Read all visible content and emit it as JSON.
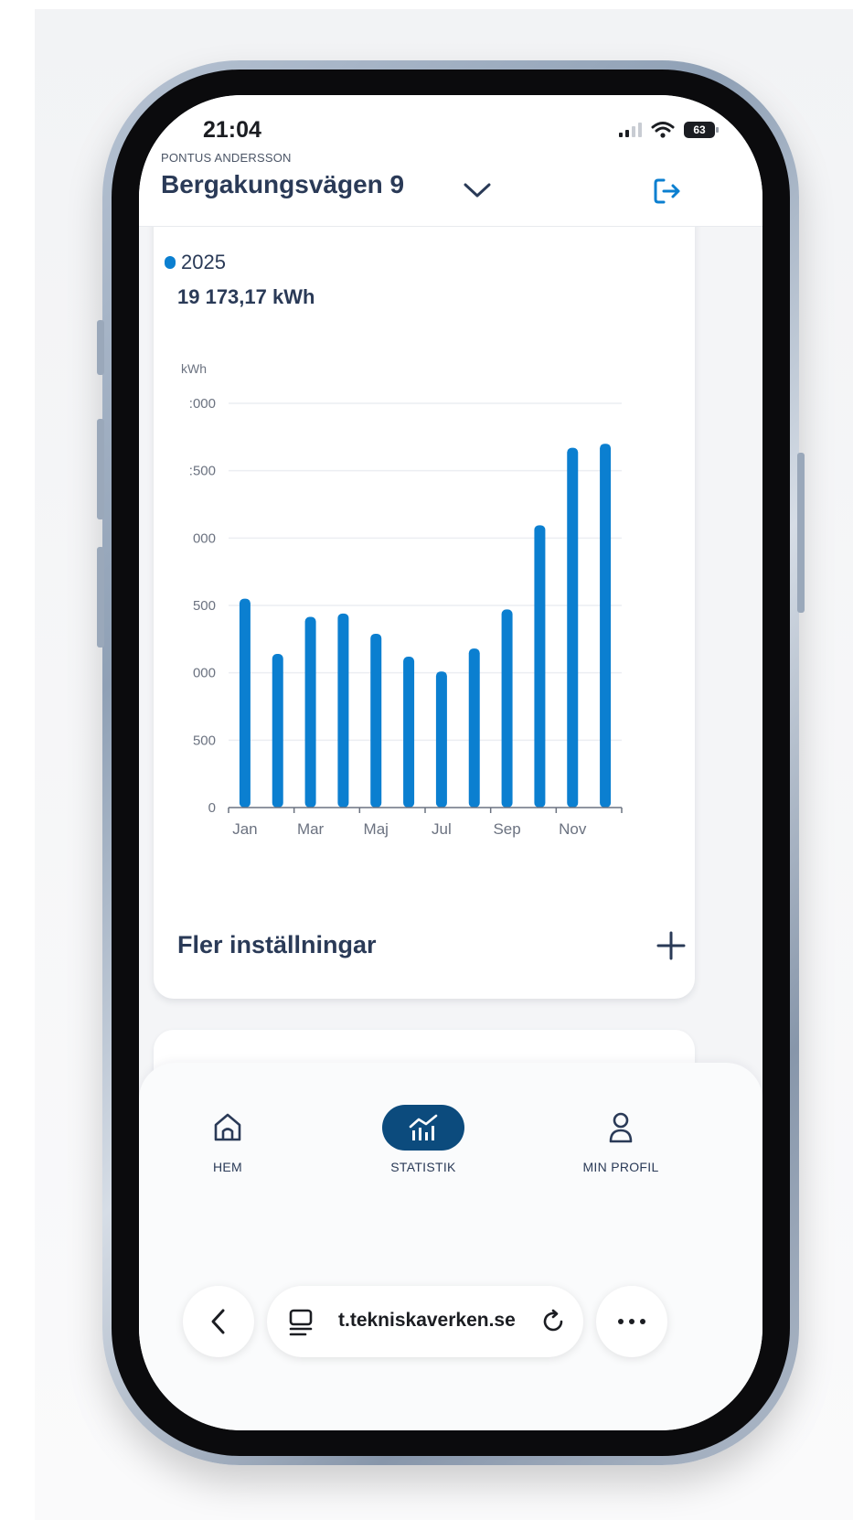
{
  "status_bar": {
    "time": "21:04",
    "battery_label": "63"
  },
  "header": {
    "user_name": "PONTUS ANDERSSON",
    "address": "Bergakungsvägen 9",
    "dropdown_icon": "chevron-down-icon",
    "logout_icon": "logout-icon"
  },
  "summary": {
    "legend_year": "2025",
    "total_value": "19 173,17 kWh",
    "legend_color": "#0b7fd0"
  },
  "chart_data": {
    "type": "bar",
    "ylabel": "kWh",
    "ylim": [
      0,
      3000
    ],
    "y_tick_labels": [
      "0",
      "500",
      "000",
      "500",
      "000",
      ":500",
      ":000"
    ],
    "y_tick_values": [
      0,
      500,
      1000,
      1500,
      2000,
      2500,
      3000
    ],
    "categories": [
      "Jan",
      "Feb",
      "Mar",
      "Apr",
      "Maj",
      "Jun",
      "Jul",
      "Aug",
      "Sep",
      "Okt",
      "Nov",
      "Dec"
    ],
    "x_tick_labels": [
      "Jan",
      "",
      "Mar",
      "",
      "Maj",
      "",
      "Jul",
      "",
      "Sep",
      "",
      "Nov",
      ""
    ],
    "values": [
      1550,
      1140,
      1415,
      1440,
      1290,
      1120,
      1010,
      1180,
      1470,
      2095,
      2670,
      2700
    ],
    "bar_color": "#0b7fd0",
    "grid": true
  },
  "settings": {
    "label": "Fler inställningar",
    "expand_icon": "plus-icon"
  },
  "nav": {
    "items": [
      {
        "label": "HEM",
        "icon": "home-icon",
        "active": false
      },
      {
        "label": "STATISTIK",
        "icon": "statistics-icon",
        "active": true
      },
      {
        "label": "MIN PROFIL",
        "icon": "profile-icon",
        "active": false
      }
    ],
    "active_color": "#0c4b7d"
  },
  "browser": {
    "url": "t.tekniskaverken.se",
    "back_icon": "back-icon",
    "tabs_icon": "tabs-icon",
    "reload_icon": "reload-icon",
    "more_icon": "more-icon"
  }
}
